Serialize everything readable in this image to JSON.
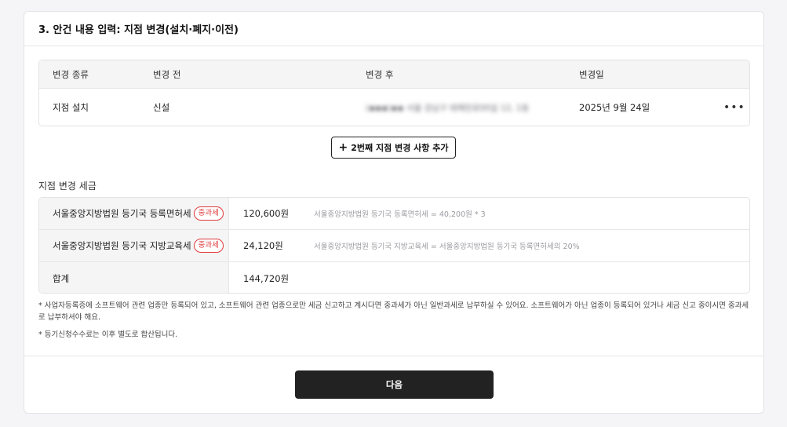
{
  "section": {
    "title": "3. 안건 내용 입력: 지점 변경(설치·폐지·이전)"
  },
  "change_table": {
    "headers": [
      "변경 종류",
      "변경 전",
      "변경 후",
      "변경일"
    ],
    "rows": [
      {
        "type": "지점 설치",
        "before": "신설",
        "after": "(◆◆◆)◆◆ 서울 강남구 테헤란로00길 12, 1동",
        "date": "2025년 9월 24일",
        "more": "•••"
      }
    ]
  },
  "add_button": {
    "plus": "+",
    "label": "2번째 지점 변경 사항 추가"
  },
  "tax": {
    "title": "지점 변경 세금",
    "rows": [
      {
        "label": "서울중앙지방법원 등기국 등록면허세",
        "badge": "중과세",
        "amount": "120,600원",
        "formula": "서울중앙지방법원 등기국 등록면허세 = 40,200원 * 3"
      },
      {
        "label": "서울중앙지방법원 등기국 지방교육세",
        "badge": "중과세",
        "amount": "24,120원",
        "formula": "서울중앙지방법원 등기국 지방교육세 = 서울중앙지방법원 등기국 등록면허세의 20%"
      },
      {
        "label": "합계",
        "amount": "144,720원"
      }
    ]
  },
  "notes": [
    "* 사업자등록증에 소프트웨어 관련 업종만 등록되어 있고, 소프트웨어 관련 업종으로만 세금 신고하고 계시다면 중과세가 아닌 일반과세로 납부하실 수 있어요. 소프트웨어가 아닌 업종이 등록되어 있거나 세금 신고 중이시면 중과세로 납부하셔야 해요.",
    "* 등기신청수수료는 이후 별도로 합산됩니다."
  ],
  "next_button": {
    "label": "다음"
  }
}
